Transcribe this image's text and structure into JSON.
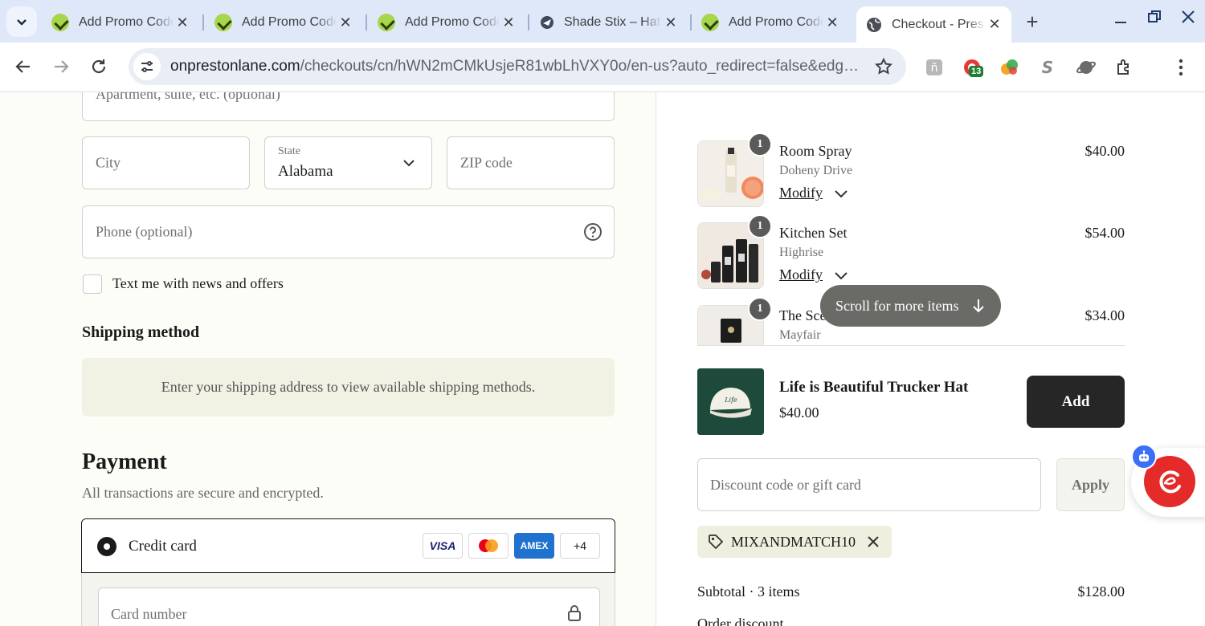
{
  "browser": {
    "tabs": [
      {
        "title": "Add Promo Code",
        "favicon": "green-check-icon",
        "active": false
      },
      {
        "title": "Add Promo Code",
        "favicon": "green-check-icon",
        "active": false
      },
      {
        "title": "Add Promo Code",
        "favicon": "green-check-icon",
        "active": false
      },
      {
        "title": "Shade Stix – Hat",
        "favicon": "shade-icon",
        "active": false
      },
      {
        "title": "Add Promo Code",
        "favicon": "green-check-icon",
        "active": false
      },
      {
        "title": "Checkout - Preston Lane",
        "favicon": "globe-icon",
        "active": true
      }
    ],
    "url_host": "onprestonlane.com",
    "url_path": "/checkouts/cn/hWN2mCMkUsjeR81wbLhVXY0o/en-us?auto_redirect=false&edge_r...",
    "extension_badge": "13"
  },
  "form": {
    "apartment_placeholder": "Apartment, suite, etc. (optional)",
    "city_placeholder": "City",
    "state_label": "State",
    "state_value": "Alabama",
    "zip_placeholder": "ZIP code",
    "phone_placeholder": "Phone (optional)",
    "sms_label": "Text me with news and offers",
    "sms_checked": false
  },
  "shipping": {
    "heading": "Shipping method",
    "message": "Enter your shipping address to view available shipping methods."
  },
  "payment": {
    "heading": "Payment",
    "subtext": "All transactions are secure and encrypted.",
    "method_label": "Credit card",
    "card_brands": [
      "VISA",
      "Mastercard",
      "AMEX"
    ],
    "more_brands": "+4",
    "card_number_placeholder": "Card number"
  },
  "cart": {
    "items": [
      {
        "name": "Room Spray",
        "variant": "Doheny Drive",
        "price": "$40.00",
        "qty": "1",
        "modify": "Modify"
      },
      {
        "name": "Kitchen Set",
        "variant": "Highrise",
        "price": "$54.00",
        "qty": "1",
        "modify": "Modify"
      },
      {
        "name": "The Sce",
        "variant": "Mayfair",
        "price": "$34.00",
        "qty": "1"
      }
    ],
    "scroll_hint": "Scroll for more items",
    "upsell": {
      "name": "Life is Beautiful Trucker Hat",
      "price": "$40.00",
      "button": "Add"
    },
    "discount_placeholder": "Discount code or gift card",
    "apply_label": "Apply",
    "applied_code": "MIXANDMATCH10",
    "subtotal_label": "Subtotal · 3 items",
    "subtotal_value": "$128.00",
    "order_discount_label": "Order discount"
  },
  "colors": {
    "accent_dark": "#262626",
    "chip_bg": "#efefdf",
    "tabbar_bg": "#dfe8f8"
  }
}
